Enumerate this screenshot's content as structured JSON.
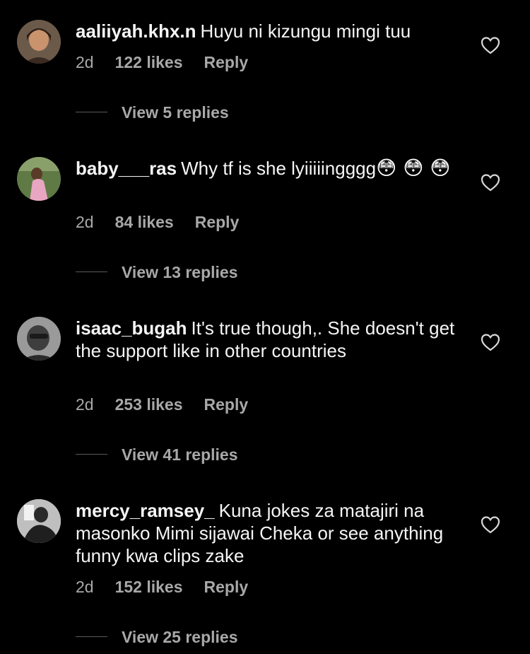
{
  "comments": [
    {
      "username": "aaliiyah.khx.n",
      "text": "Huyu ni kizungu mingi tuu",
      "emoji": "",
      "time": "2d",
      "likes": "122 likes",
      "reply": "Reply",
      "view_replies": "View 5 replies"
    },
    {
      "username": "baby___ras",
      "text": "Why tf is she lyiiiiingggg",
      "emoji": "😳 😳 😳",
      "time": "2d",
      "likes": "84 likes",
      "reply": "Reply",
      "view_replies": "View 13 replies"
    },
    {
      "username": "isaac_bugah",
      "text": "It's true though,. She doesn't get the support like in other countries",
      "emoji": "",
      "time": "2d",
      "likes": "253 likes",
      "reply": "Reply",
      "view_replies": "View 41 replies"
    },
    {
      "username": "mercy_ramsey_",
      "text": "Kuna jokes za matajiri na masonko Mimi sijawai Cheka or see anything funny kwa clips zake",
      "emoji": "",
      "time": "2d",
      "likes": "152 likes",
      "reply": "Reply",
      "view_replies": "View 25 replies"
    }
  ],
  "colors": {
    "background": "#000000",
    "text": "#f5f5f5",
    "secondary_text": "#a8a8a8"
  },
  "icons": {
    "like": "heart-outline-icon"
  }
}
